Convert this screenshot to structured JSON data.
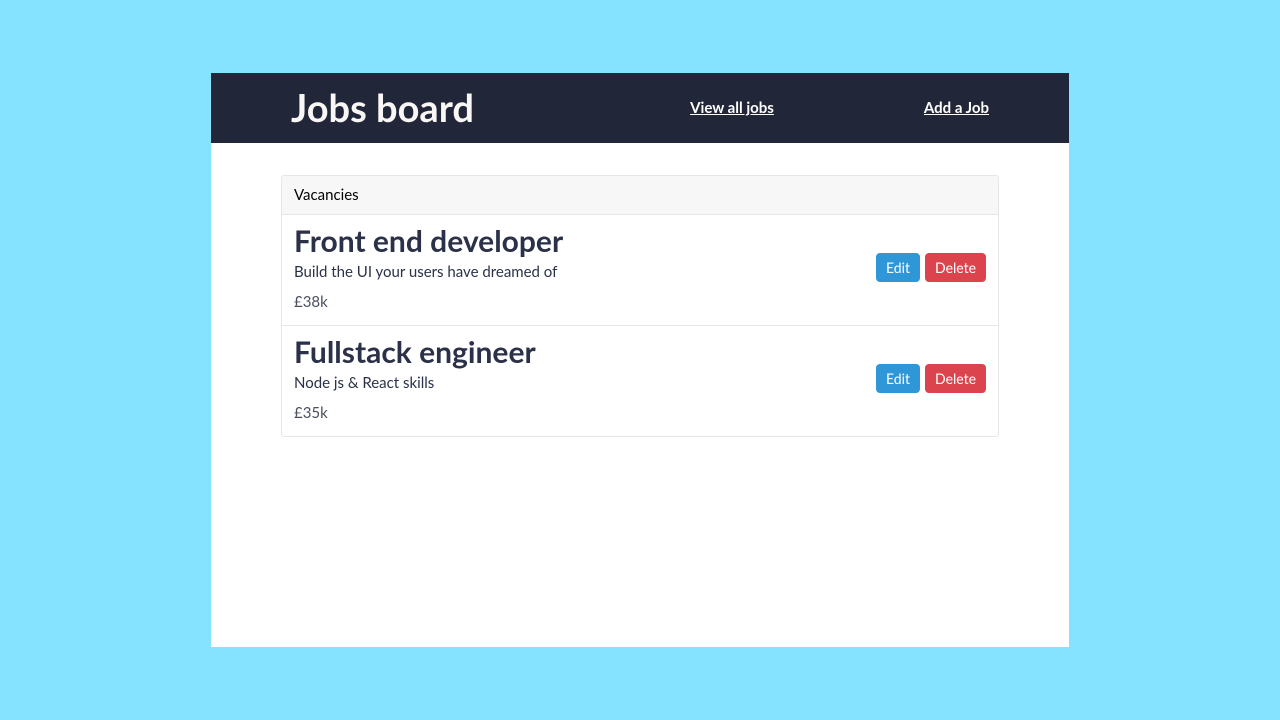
{
  "navbar": {
    "title": "Jobs board",
    "view_all": "View all jobs",
    "add_job": "Add a Job"
  },
  "panel": {
    "header": "Vacancies"
  },
  "jobs": [
    {
      "title": "Front end developer",
      "description": "Build the UI your users have dreamed of",
      "salary": "£38k",
      "edit": "Edit",
      "delete": "Delete"
    },
    {
      "title": "Fullstack engineer",
      "description": "Node js & React skills",
      "salary": "£35k",
      "edit": "Edit",
      "delete": "Delete"
    }
  ]
}
